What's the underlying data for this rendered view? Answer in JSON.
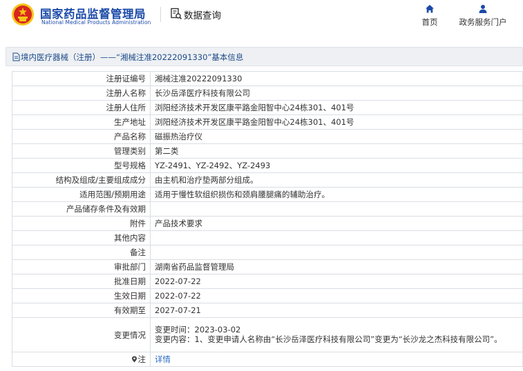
{
  "header": {
    "org_name_cn": "国家药品监督管理局",
    "org_name_en": "National Medical Products Administration",
    "query_label": "数据查询",
    "nav": [
      {
        "label": "首页",
        "icon": "home-icon"
      },
      {
        "label": "政务服务门户",
        "icon": "user-icon"
      }
    ]
  },
  "breadcrumb": {
    "text": "境内医疗器械（注册）——“湘械注准20222091330”基本信息",
    "icon": "document-icon"
  },
  "records": [
    {
      "label": "注册证编号",
      "value": "湘械注准20222091330"
    },
    {
      "label": "注册人名称",
      "value": "长沙岳泽医疗科技有限公司"
    },
    {
      "label": "注册人住所",
      "value": "浏阳经济技术开发区康平路金阳智中心24栋301、401号"
    },
    {
      "label": "生产地址",
      "value": "浏阳经济技术开发区康平路金阳智中心24栋301、401号"
    },
    {
      "label": "产品名称",
      "value": "磁振热治疗仪"
    },
    {
      "label": "管理类别",
      "value": "第二类"
    },
    {
      "label": "型号规格",
      "value": "YZ-2491、YZ-2492、YZ-2493"
    },
    {
      "label": "结构及组成/主要组成成分",
      "value": "由主机和治疗垫两部分组成。"
    },
    {
      "label": "适用范围/预期用途",
      "value": "适用于慢性软组织损伤和颈肩腰腿痛的辅助治疗。"
    },
    {
      "label": "产品储存条件及有效期",
      "value": ""
    },
    {
      "label": "附件",
      "value": "产品技术要求"
    },
    {
      "label": "其他内容",
      "value": ""
    },
    {
      "label": "备注",
      "value": ""
    },
    {
      "label": "审批部门",
      "value": "湖南省药品监督管理局"
    },
    {
      "label": "批准日期",
      "value": "2022-07-22"
    },
    {
      "label": "生效日期",
      "value": "2022-07-22"
    },
    {
      "label": "有效期至",
      "value": "2027-07-21"
    }
  ],
  "change": {
    "label": "变更情况",
    "time": "变更时间：2023-03-02",
    "content": "变更内容：1、变更申请人名称由“长沙岳泽医疗科技有限公司”变更为“长沙龙之杰科技有限公司”。"
  },
  "note": {
    "label": "注",
    "link": "详情"
  },
  "colors": {
    "brand_blue": "#1b4aa8",
    "link_blue": "#2a6cc4",
    "emblem_red": "#d7261e",
    "emblem_gold": "#f5c518"
  }
}
